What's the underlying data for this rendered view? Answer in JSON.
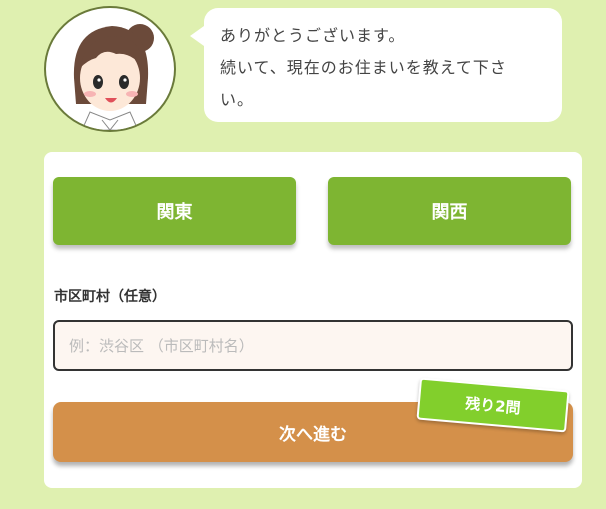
{
  "chat": {
    "lines": [
      "ありがとうございます。",
      "続いて、現在のお住まいを教えて下さ",
      "い。"
    ]
  },
  "regions": {
    "kanto_label": "関東",
    "kansai_label": "関西"
  },
  "city": {
    "label": "市区町村（任意）",
    "placeholder": "例：渋谷区 （市区町村名）",
    "value": ""
  },
  "actions": {
    "next_label": "次へ進む",
    "remaining_label": "残り2問"
  },
  "colors": {
    "background": "#dff0b0",
    "region_button": "#7eb532",
    "next_button": "#d4904a",
    "badge": "#82cf2c"
  }
}
